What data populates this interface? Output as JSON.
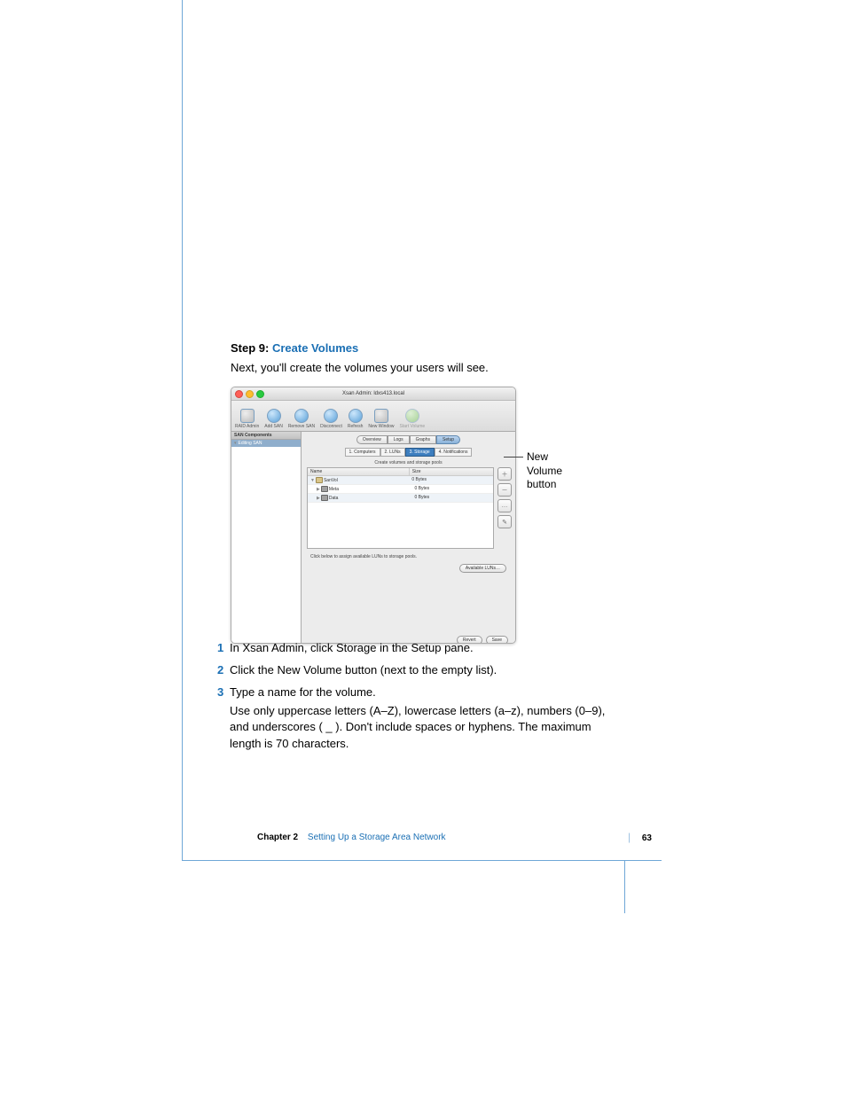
{
  "heading": {
    "prefix": "Step 9: ",
    "title": "Create Volumes"
  },
  "intro": "Next, you'll create the volumes your users will see.",
  "window": {
    "title": "Xsan Admin: ldxs413.local",
    "toolbar": [
      "RAID Admin",
      "Add SAN",
      "Remove SAN",
      "Disconnect",
      "Refresh",
      "New Window",
      "Start Volume"
    ],
    "sidebar": {
      "header": "SAN Components",
      "item": "Editing SAN"
    },
    "viewTabs": [
      "Overview",
      "Logs",
      "Graphs",
      "Setup"
    ],
    "setupTabs": [
      "1. Computers",
      "2. LUNs",
      "3. Storage",
      "4. Notifications"
    ],
    "sectionLabel": "Create volumes and storage pools",
    "tableHeaders": {
      "name": "Name",
      "size": "Size"
    },
    "rows": [
      {
        "indent": 0,
        "tri": "▼",
        "icon": "vol",
        "name": "SanVol",
        "size": "0 Bytes"
      },
      {
        "indent": 1,
        "tri": "▶",
        "icon": "pool",
        "name": "Meta",
        "size": "0 Bytes"
      },
      {
        "indent": 1,
        "tri": "▶",
        "icon": "pool",
        "name": "Data",
        "size": "0 Bytes"
      }
    ],
    "sideButtons": [
      "＋",
      "－",
      "…",
      "✎"
    ],
    "hint": "Click below to assign available LUNs to storage pools.",
    "availableBtn": "Available LUNs…",
    "revertBtn": "Revert",
    "saveBtn": "Save"
  },
  "callout": {
    "line1": "New Volume",
    "line2": "button"
  },
  "steps": [
    {
      "n": "1",
      "text": "In Xsan Admin, click Storage in the Setup pane."
    },
    {
      "n": "2",
      "text": "Click the New Volume button (next to the empty list)."
    },
    {
      "n": "3",
      "text": "Type a name for the volume.",
      "extra": "Use only uppercase letters (A–Z), lowercase letters (a–z), numbers (0–9), and underscores ( _ ). Don't include spaces or hyphens. The maximum length is 70 characters."
    }
  ],
  "footer": {
    "chapter": "Chapter 2",
    "title": "Setting Up a Storage Area Network",
    "page": "63"
  }
}
